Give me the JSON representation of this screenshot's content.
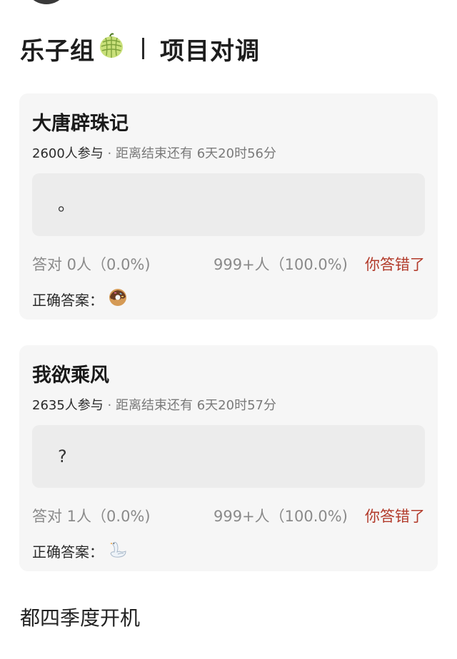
{
  "header": {
    "group_name": "乐子组",
    "group_emoji": "melon-icon",
    "section_title": "项目对调"
  },
  "cards": [
    {
      "title": "大唐辟珠记",
      "participants": "2600人参与",
      "time_left": "· 距离结束还有 6天20时56分",
      "answer": "。",
      "correct_stat": "答对  0人（0.0%)",
      "wrong_stat": "999+人（100.0%)",
      "verdict": "你答错了",
      "correct_label": "正确答案：",
      "correct_emoji": "donut-icon"
    },
    {
      "title": "我欲乘风",
      "participants": "2635人参与",
      "time_left": "· 距离结束还有 6天20时57分",
      "answer": "?",
      "correct_stat": "答对  1人（0.0%)",
      "wrong_stat": "999+人（100.0%)",
      "verdict": "你答错了",
      "correct_label": "正确答案：",
      "correct_emoji": "swan-icon"
    }
  ],
  "footer": {
    "text": "都四季度开机"
  },
  "colors": {
    "card_bg": "#f6f6f6",
    "answer_box_bg": "#ececec",
    "verdict": "#b23a2a",
    "muted": "#8a8a8a"
  }
}
